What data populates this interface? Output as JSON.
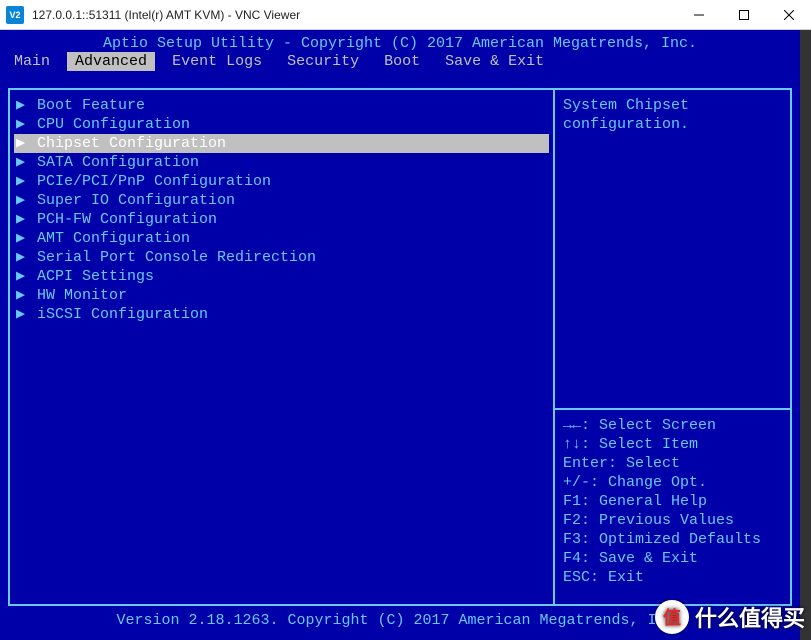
{
  "window": {
    "title": "127.0.0.1::51311 (Intel(r) AMT KVM) - VNC Viewer",
    "app_icon_text": "V2"
  },
  "bios": {
    "header": "Aptio Setup Utility - Copyright (C) 2017 American Megatrends, Inc.",
    "footer": "Version 2.18.1263. Copyright (C) 2017 American Megatrends, Inc.",
    "tabs": [
      {
        "label": "Main"
      },
      {
        "label": "Advanced",
        "active": true
      },
      {
        "label": "Event Logs"
      },
      {
        "label": "Security"
      },
      {
        "label": "Boot"
      },
      {
        "label": "Save & Exit"
      }
    ],
    "items": [
      "Boot Feature",
      "CPU Configuration",
      "Chipset Configuration",
      "SATA Configuration",
      "PCIe/PCI/PnP Configuration",
      "Super IO Configuration",
      "PCH-FW Configuration",
      "AMT Configuration",
      "Serial Port Console Redirection",
      "ACPI Settings",
      "HW Monitor",
      "iSCSI Configuration"
    ],
    "selected_index": 2,
    "help_text": "System Chipset configuration.",
    "keyhints": [
      "→←: Select Screen",
      "↑↓: Select Item",
      "Enter: Select",
      "+/-: Change Opt.",
      "F1: General Help",
      "F2: Previous Values",
      "F3: Optimized Defaults",
      "F4: Save & Exit",
      "ESC: Exit"
    ]
  },
  "watermark": {
    "icon_text": "值",
    "text": "什么值得买"
  }
}
